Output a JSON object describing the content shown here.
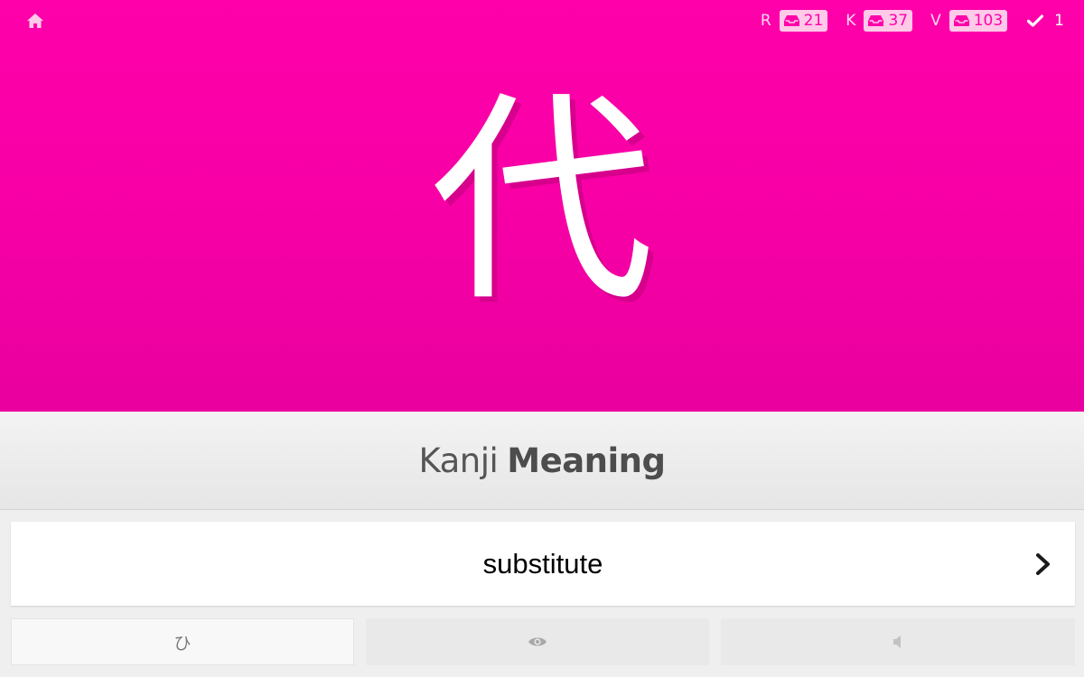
{
  "header": {
    "home_icon": "home-icon",
    "stats": [
      {
        "letter": "R",
        "count": "21",
        "icon": "inbox-icon"
      },
      {
        "letter": "K",
        "count": "37",
        "icon": "inbox-icon"
      },
      {
        "letter": "V",
        "count": "103",
        "icon": "inbox-icon"
      }
    ],
    "done": {
      "icon": "check-icon",
      "count": "1"
    }
  },
  "question": {
    "character": "代"
  },
  "prompt": {
    "category": "Kanji",
    "type": "Meaning"
  },
  "answer": {
    "value": "substitute",
    "placeholder": "",
    "submit_icon": "chevron-right-icon"
  },
  "extras": [
    {
      "label": "ひ",
      "icon": ""
    },
    {
      "label": "",
      "icon": "eye-icon"
    },
    {
      "label": "",
      "icon": "volume-icon"
    }
  ],
  "colors": {
    "accent": "#ff00aa",
    "badge_bg": "#ffc9e8",
    "prompt_bg": "#e9e9e9"
  }
}
